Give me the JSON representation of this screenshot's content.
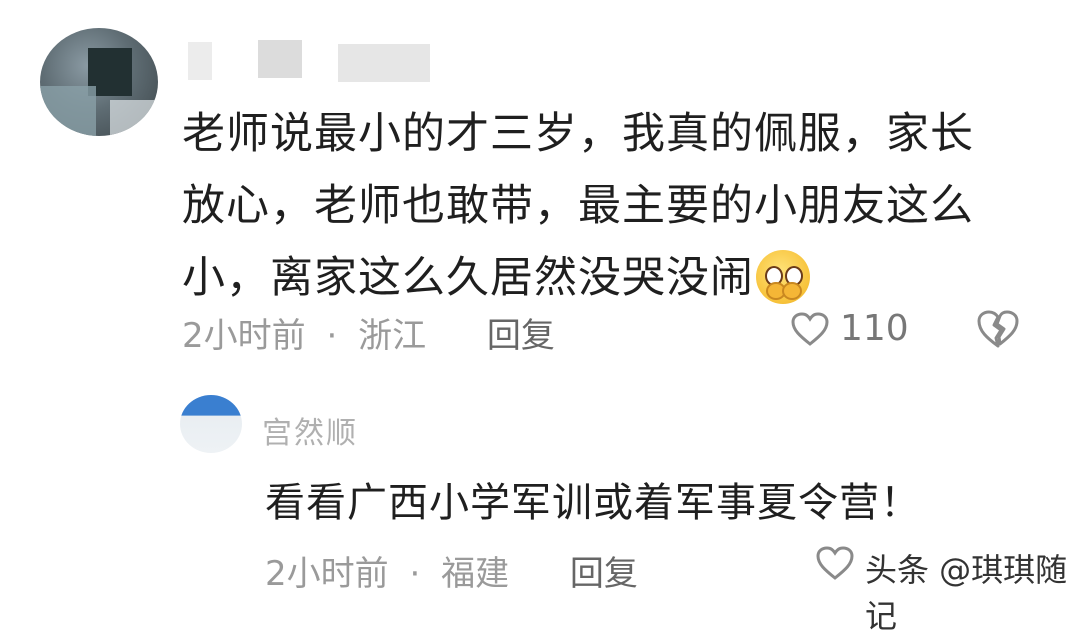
{
  "comment1": {
    "text_lines": [
      "老师说最小的才三岁，我真的佩服，家长",
      "放心，老师也敢带，最主要的小朋友这么",
      "小，离家这么久居然没哭没闹"
    ],
    "emoji": "pleading-face-emoji",
    "time": "2小时前",
    "separator": "·",
    "location": "浙江",
    "reply_label": "回复",
    "like_count": "110",
    "icons": [
      "heart-icon",
      "broken-heart-icon"
    ]
  },
  "comment2": {
    "username": "宫然顺",
    "text": "看看广西小学军训或着军事夏令营！",
    "time": "2小时前",
    "separator": "·",
    "location": "福建",
    "reply_label": "回复",
    "icons": [
      "heart-icon"
    ]
  },
  "watermark": "头条 @琪琪随记",
  "colors": {
    "text": "#1f1f1f",
    "meta": "#9a9a9a",
    "icon": "#888888",
    "avatar2_accent": "#3a7fd0"
  }
}
